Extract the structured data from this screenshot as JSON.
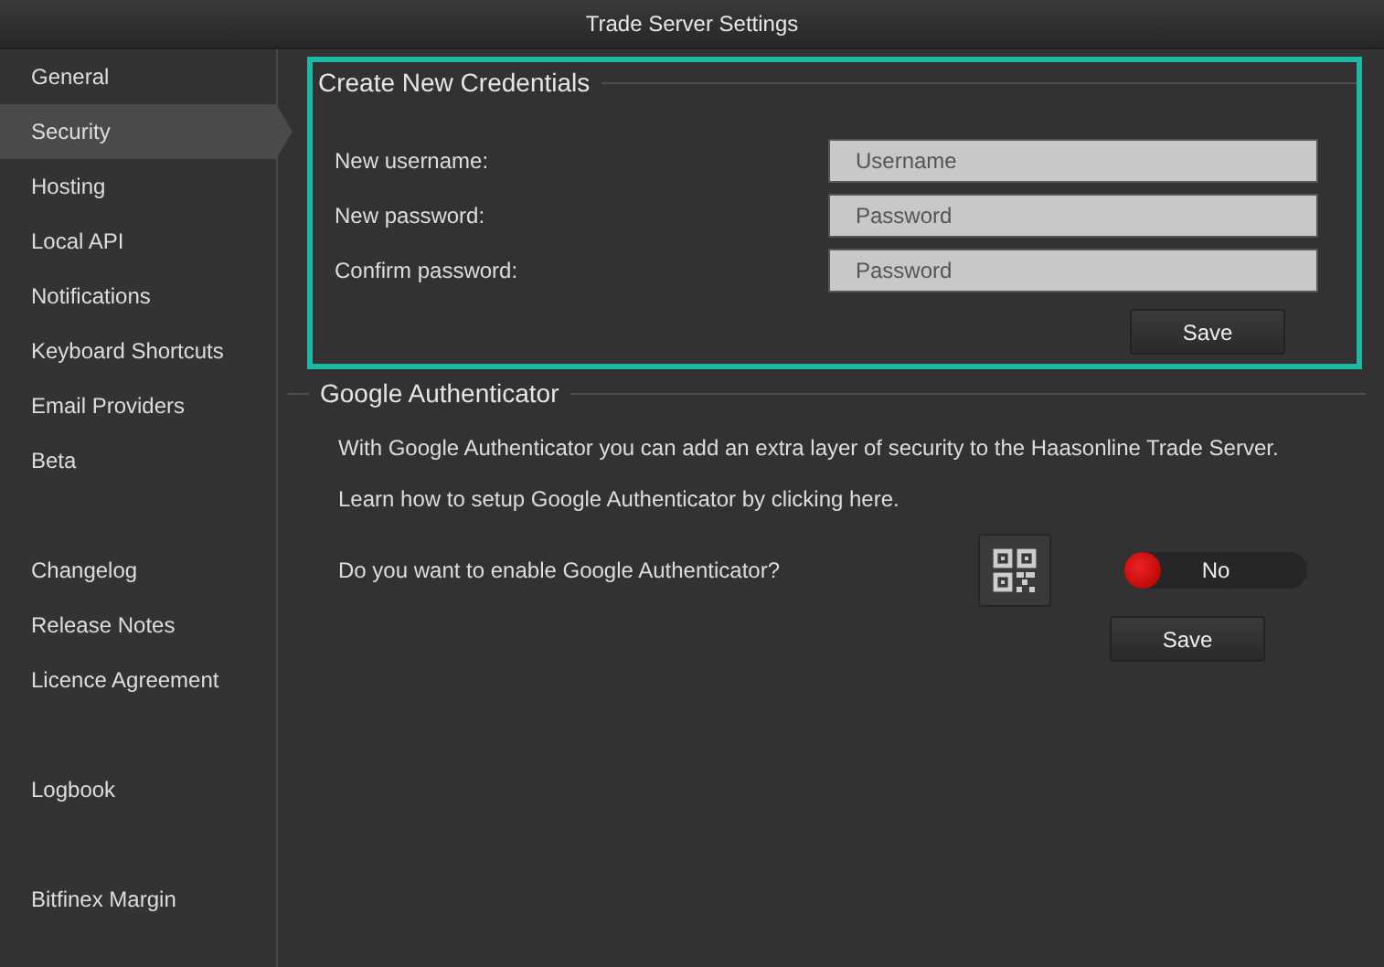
{
  "window": {
    "title": "Trade Server Settings"
  },
  "sidebar": {
    "groups": [
      {
        "items": [
          {
            "label": "General",
            "selected": false
          },
          {
            "label": "Security",
            "selected": true
          },
          {
            "label": "Hosting",
            "selected": false
          },
          {
            "label": "Local API",
            "selected": false
          },
          {
            "label": "Notifications",
            "selected": false
          },
          {
            "label": "Keyboard Shortcuts",
            "selected": false
          },
          {
            "label": "Email Providers",
            "selected": false
          },
          {
            "label": "Beta",
            "selected": false
          }
        ]
      },
      {
        "items": [
          {
            "label": "Changelog",
            "selected": false
          },
          {
            "label": "Release Notes",
            "selected": false
          },
          {
            "label": "Licence Agreement",
            "selected": false
          }
        ]
      },
      {
        "items": [
          {
            "label": "Logbook",
            "selected": false
          }
        ]
      },
      {
        "items": [
          {
            "label": "Bitfinex Margin",
            "selected": false
          }
        ]
      }
    ]
  },
  "credentials": {
    "title": "Create New Credentials",
    "highlighted": true,
    "fields": [
      {
        "label": "New username:",
        "placeholder": "Username"
      },
      {
        "label": "New password:",
        "placeholder": "Password"
      },
      {
        "label": "Confirm password:",
        "placeholder": "Password"
      }
    ],
    "save_button": "Save"
  },
  "authenticator": {
    "title": "Google Authenticator",
    "description": "With Google Authenticator you can add an extra layer of security to the Haasonline Trade Server.",
    "help": "Learn how to setup Google Authenticator by clicking here.",
    "question": "Do you want to enable Google Authenticator?",
    "toggle": {
      "on": false,
      "label": "No"
    },
    "save_button": "Save"
  }
}
